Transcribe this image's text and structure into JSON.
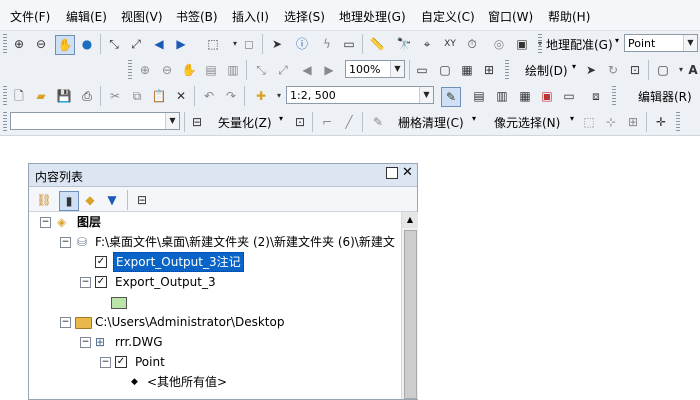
{
  "menu": [
    "文件(F)",
    "编辑(E)",
    "视图(V)",
    "书签(B)",
    "插入(I)",
    "选择(S)",
    "地理处理(G)",
    "自定义(C)",
    "窗口(W)",
    "帮助(H)"
  ],
  "toolbar1": {
    "georef_label": "地理配准(G)",
    "layer_combo": "Point"
  },
  "toolbar2": {
    "zoom_combo": "100%",
    "draw_label": "绘制(D)"
  },
  "toolbar3": {
    "scale_combo": "1:2, 500",
    "editor_label": "编辑器(R)"
  },
  "toolbar4": {
    "raster_layer_combo": "",
    "vectorize_label": "矢量化(Z)",
    "raster_cleanup_label": "栅格清理(C)",
    "cell_select_label": "像元选择(N)"
  },
  "toc": {
    "title": "内容列表",
    "root_label": "图层",
    "gdb_path": "F:\\桌面文件\\桌面\\新建文件夹 (2)\\新建文件夹 (6)\\新建文",
    "layer1": "Export_Output_3注记",
    "layer2": "Export_Output_3",
    "folder_path": "C:\\Users\\Administrator\\Desktop",
    "dwg_name": "rrr.DWG",
    "point_layer": "Point",
    "other_values": "<其他所有值>"
  },
  "colors": {
    "selection": "#0a64c8",
    "polygon_swatch_fill": "#b9e6a8",
    "folder": "#e8b84a"
  }
}
